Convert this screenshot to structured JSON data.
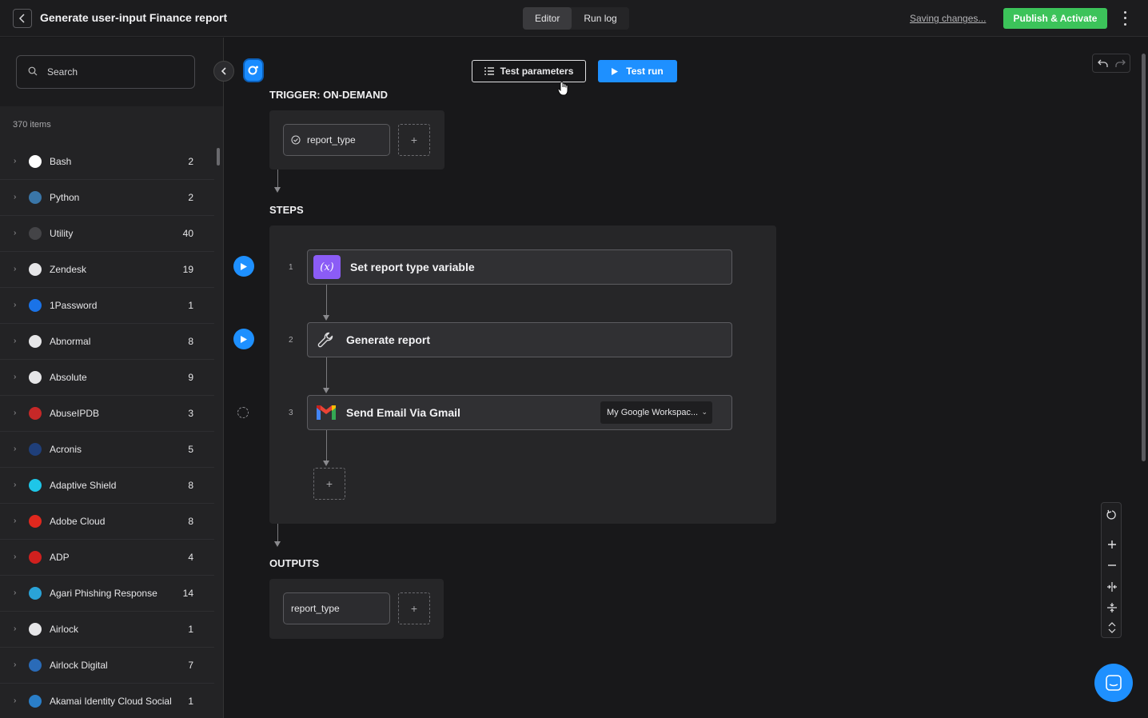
{
  "header": {
    "title": "Generate user-input Finance report",
    "tabs": [
      {
        "label": "Editor",
        "active": true
      },
      {
        "label": "Run log",
        "active": false
      }
    ],
    "saving_text": "Saving changes...",
    "publish_label": "Publish & Activate"
  },
  "sidebar": {
    "search_placeholder": "Search",
    "count_label": "370 items",
    "items": [
      {
        "name": "Bash",
        "count": "2",
        "color": "#ffffff"
      },
      {
        "name": "Python",
        "count": "2",
        "color": "#3a76a8"
      },
      {
        "name": "Utility",
        "count": "40",
        "color": "#444447"
      },
      {
        "name": "Zendesk",
        "count": "19",
        "color": "#e6e6e8"
      },
      {
        "name": "1Password",
        "count": "1",
        "color": "#1a73e8"
      },
      {
        "name": "Abnormal",
        "count": "8",
        "color": "#e6e6e8"
      },
      {
        "name": "Absolute",
        "count": "9",
        "color": "#e6e6e8"
      },
      {
        "name": "AbuseIPDB",
        "count": "3",
        "color": "#c62828"
      },
      {
        "name": "Acronis",
        "count": "5",
        "color": "#1f3f7a"
      },
      {
        "name": "Adaptive Shield",
        "count": "8",
        "color": "#1ec6e8"
      },
      {
        "name": "Adobe Cloud",
        "count": "8",
        "color": "#e0281e"
      },
      {
        "name": "ADP",
        "count": "4",
        "color": "#d0201e"
      },
      {
        "name": "Agari Phishing Response",
        "count": "14",
        "color": "#2aa3d8"
      },
      {
        "name": "Airlock",
        "count": "1",
        "color": "#e6e6e8"
      },
      {
        "name": "Airlock Digital",
        "count": "7",
        "color": "#2a6bb8"
      },
      {
        "name": "Akamai Identity Cloud Social",
        "count": "1",
        "color": "#2a7ec8"
      }
    ]
  },
  "toolbar": {
    "test_params_label": "Test parameters",
    "test_run_label": "Test run"
  },
  "trigger": {
    "label": "TRIGGER: ON-DEMAND",
    "param": "report_type",
    "add_symbol": "+"
  },
  "steps": {
    "label": "STEPS",
    "items": [
      {
        "num": "1",
        "title": "Set report type variable",
        "icon": "variable-icon",
        "color": "#8b5cf6"
      },
      {
        "num": "2",
        "title": "Generate report",
        "icon": "wrench-icon"
      },
      {
        "num": "3",
        "title": "Send Email Via Gmail",
        "icon": "gmail-icon",
        "account": "My Google Workspac..."
      }
    ],
    "add_symbol": "+"
  },
  "outputs": {
    "label": "OUTPUTS",
    "param": "report_type",
    "add_symbol": "+"
  },
  "colors": {
    "accent": "#1e90ff",
    "publish": "#3cc35a",
    "background": "#18181a"
  }
}
